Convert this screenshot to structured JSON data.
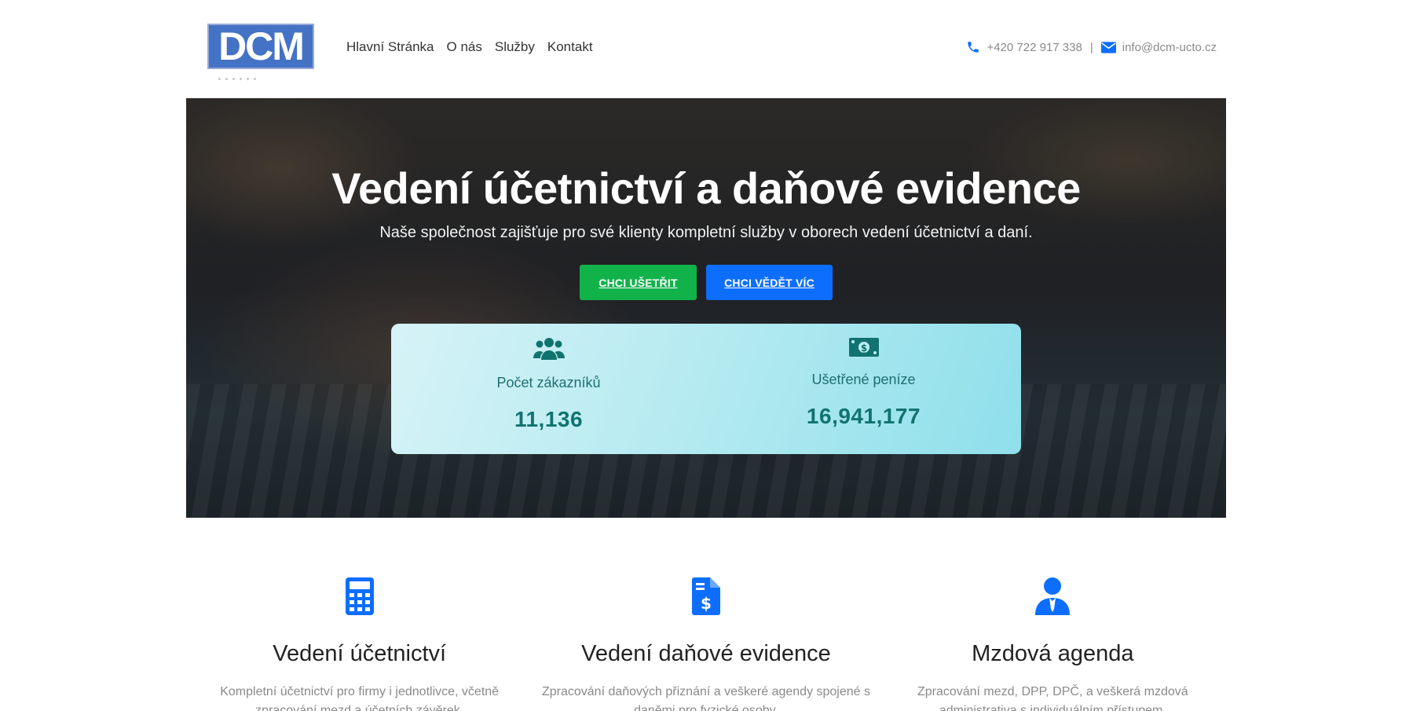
{
  "brand": {
    "logo_text": "DCM"
  },
  "nav": {
    "items": [
      "Hlavní Stránka",
      "O nás",
      "Služby",
      "Kontakt"
    ]
  },
  "contact": {
    "phone": "+420 722 917 338",
    "separator": "|",
    "email": "info@dcm-ucto.cz"
  },
  "hero": {
    "title": "Vedení účetnictví a daňové evidence",
    "subtitle": "Naše společnost zajišťuje pro své klienty kompletní služby v oborech vedení účetnictví a daní.",
    "primary_button": "CHCI UŠETŘIT",
    "secondary_button": "CHCI VĚDĚT VÍC"
  },
  "stats": [
    {
      "icon": "users-icon",
      "label": "Počet zákazníků",
      "value": "11,136"
    },
    {
      "icon": "money-bill-icon",
      "label": "Ušetřené peníze",
      "value": "16,941,177"
    }
  ],
  "services": [
    {
      "icon": "calculator-icon",
      "title": "Vedení účetnictví",
      "description": "Kompletní účetnictví pro firmy i jednotlivce, včetně zpracování mezd a účetních závěrek."
    },
    {
      "icon": "invoice-dollar-icon",
      "title": "Vedení daňové evidence",
      "description": "Zpracování daňových přiznání a veškeré agendy spojené s daněmi pro fyzické osoby."
    },
    {
      "icon": "user-tie-icon",
      "title": "Mzdová agenda",
      "description": "Zpracování mezd, DPP, DPČ, a veškerá mzdová administrativa s individuálním přístupem."
    }
  ],
  "colors": {
    "brand_blue": "#4472c4",
    "accent_blue": "#0d6efd",
    "accent_green": "#12b24b",
    "stat_teal": "#11736f"
  }
}
